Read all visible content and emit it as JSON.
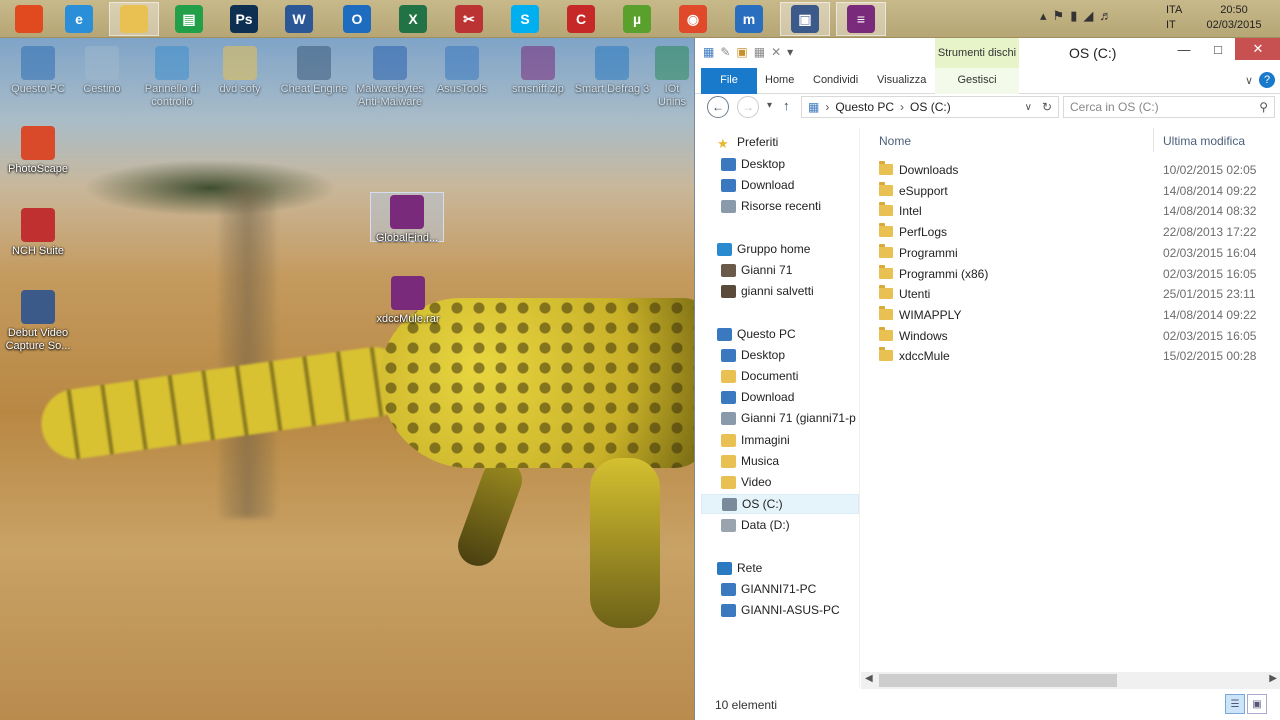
{
  "taskbar": {
    "apps": [
      {
        "icon": "windows-start-icon",
        "color": "#e04a1e",
        "glyph": "",
        "active": false
      },
      {
        "icon": "internet-explorer-icon",
        "color": "#2a8fd8",
        "glyph": "e",
        "active": false
      },
      {
        "icon": "file-explorer-icon",
        "color": "#e8c152",
        "glyph": "",
        "active": true
      },
      {
        "icon": "store-icon",
        "color": "#22a049",
        "glyph": "▤",
        "active": false
      },
      {
        "icon": "photoshop-icon",
        "color": "#0c2f52",
        "glyph": "Ps",
        "active": false
      },
      {
        "icon": "word-icon",
        "color": "#2b5797",
        "glyph": "W",
        "active": false
      },
      {
        "icon": "outlook-icon",
        "color": "#1e6cbf",
        "glyph": "O",
        "active": false
      },
      {
        "icon": "excel-icon",
        "color": "#217346",
        "glyph": "X",
        "active": false
      },
      {
        "icon": "snipping-tool-icon",
        "color": "#b33",
        "glyph": "✂",
        "active": false
      },
      {
        "icon": "skype-icon",
        "color": "#00aff0",
        "glyph": "S",
        "active": false
      },
      {
        "icon": "ccleaner-icon",
        "color": "#c62828",
        "glyph": "C",
        "active": false
      },
      {
        "icon": "utorrent-icon",
        "color": "#5aa02c",
        "glyph": "µ",
        "active": false
      },
      {
        "icon": "chrome-icon",
        "color": "#e04a2a",
        "glyph": "◉",
        "active": false
      },
      {
        "icon": "maxthon-icon",
        "color": "#2a6fbf",
        "glyph": "m",
        "active": false
      },
      {
        "icon": "debut-video-icon",
        "color": "#3b5a8a",
        "glyph": "▣",
        "active": true
      },
      {
        "icon": "winrar-icon",
        "color": "#7a2a7a",
        "glyph": "≡",
        "active": true
      }
    ],
    "tray": {
      "lang_top": "ITA",
      "lang_bottom": "IT",
      "time": "20:50",
      "date": "02/03/2015"
    }
  },
  "desktop": {
    "icons": [
      {
        "label": "Questo PC",
        "name": "this-pc-icon",
        "color": "#2f6fb5",
        "faded": true
      },
      {
        "label": "Cestino",
        "name": "recycle-bin-icon",
        "color": "#9fb8cc",
        "faded": true
      },
      {
        "label": "Pannello di controllo",
        "name": "control-panel-icon",
        "color": "#3d8fcf",
        "faded": true
      },
      {
        "label": "dvd sofy",
        "name": "dvd-sofy-folder-icon",
        "color": "#e8c152",
        "faded": true
      },
      {
        "label": "Cheat Engine",
        "name": "cheat-engine-icon",
        "color": "#3a5a7a",
        "faded": true
      },
      {
        "label": "Malwarebytes Anti-Malware",
        "name": "malwarebytes-icon",
        "color": "#2a62b0",
        "faded": true
      },
      {
        "label": "AsusTools",
        "name": "asustools-icon",
        "color": "#3a78c0",
        "faded": true
      },
      {
        "label": "smsniff.zip",
        "name": "smsniff-zip-icon",
        "color": "#7a2a7a",
        "faded": true
      },
      {
        "label": "Smart Defrag 3",
        "name": "smart-defrag-icon",
        "color": "#2a7ac0",
        "faded": true
      },
      {
        "label": "IOt Unins",
        "name": "iobit-uninstaller-icon",
        "color": "#2a8a5a",
        "faded": true
      },
      {
        "label": "PhotoScape",
        "name": "photoscape-icon",
        "color": "#d84a2a",
        "faded": false
      },
      {
        "label": "NCH Suite",
        "name": "nch-suite-icon",
        "color": "#c03030",
        "faded": false
      },
      {
        "label": "Debut Video Capture So...",
        "name": "debut-video-capture-icon",
        "color": "#3b5a8a",
        "faded": false
      },
      {
        "label": "GlobalFind...",
        "name": "globalfind-rar-icon",
        "color": "#7a2a7a",
        "faded": false
      },
      {
        "label": "xdccMule.rar",
        "name": "xdccmule-rar-icon",
        "color": "#7a2a7a",
        "faded": false
      }
    ]
  },
  "explorer": {
    "title": "OS (C:)",
    "context_tab_title": "Strumenti dischi",
    "ribbon_tabs": [
      "File",
      "Home",
      "Condividi",
      "Visualizza",
      "Gestisci"
    ],
    "address": [
      "Questo PC",
      "OS (C:)"
    ],
    "search_placeholder": "Cerca in OS (C:)",
    "nav": [
      {
        "label": "Preferiti",
        "level": 0,
        "icon": "star-icon",
        "color": "#e8b830"
      },
      {
        "label": "Desktop",
        "level": 1,
        "icon": "desktop-icon",
        "color": "#3a78c0"
      },
      {
        "label": "Download",
        "level": 1,
        "icon": "download-folder-icon",
        "color": "#3a78c0"
      },
      {
        "label": "Risorse recenti",
        "level": 1,
        "icon": "recent-places-icon",
        "color": "#8a9aaa"
      },
      {
        "label": "Gruppo home",
        "level": 0,
        "icon": "homegroup-icon",
        "color": "#2a8ad0"
      },
      {
        "label": "Gianni 71",
        "level": 1,
        "icon": "user-avatar-icon",
        "color": "#6a5a4a"
      },
      {
        "label": "gianni salvetti",
        "level": 1,
        "icon": "user-avatar-icon",
        "color": "#5a4a3a"
      },
      {
        "label": "Questo PC",
        "level": 0,
        "icon": "this-pc-icon",
        "color": "#3a78c0"
      },
      {
        "label": "Desktop",
        "level": 1,
        "icon": "desktop-icon",
        "color": "#3a78c0"
      },
      {
        "label": "Documenti",
        "level": 1,
        "icon": "documents-folder-icon",
        "color": "#e8c152"
      },
      {
        "label": "Download",
        "level": 1,
        "icon": "download-folder-icon",
        "color": "#3a78c0"
      },
      {
        "label": "Gianni 71 (gianni71-p",
        "level": 1,
        "icon": "user-folder-icon",
        "color": "#8a9aaa"
      },
      {
        "label": "Immagini",
        "level": 1,
        "icon": "pictures-folder-icon",
        "color": "#e8c152"
      },
      {
        "label": "Musica",
        "level": 1,
        "icon": "music-folder-icon",
        "color": "#e8c152"
      },
      {
        "label": "Video",
        "level": 1,
        "icon": "videos-folder-icon",
        "color": "#e8c152"
      },
      {
        "label": "OS (C:)",
        "level": 1,
        "icon": "drive-c-icon",
        "color": "#7a8a9a",
        "selected": true
      },
      {
        "label": "Data (D:)",
        "level": 1,
        "icon": "drive-d-icon",
        "color": "#9aa4ae"
      },
      {
        "label": "Rete",
        "level": 0,
        "icon": "network-icon",
        "color": "#2a7ac0"
      },
      {
        "label": "GIANNI71-PC",
        "level": 1,
        "icon": "network-pc-icon",
        "color": "#3a78c0"
      },
      {
        "label": "GIANNI-ASUS-PC",
        "level": 1,
        "icon": "network-pc-icon",
        "color": "#3a78c0"
      }
    ],
    "columns": {
      "name": "Nome",
      "modified": "Ultima modifica"
    },
    "files": [
      {
        "name": "Downloads",
        "date": "10/02/2015 02:05"
      },
      {
        "name": "eSupport",
        "date": "14/08/2014 09:22"
      },
      {
        "name": "Intel",
        "date": "14/08/2014 08:32"
      },
      {
        "name": "PerfLogs",
        "date": "22/08/2013 17:22"
      },
      {
        "name": "Programmi",
        "date": "02/03/2015 16:04"
      },
      {
        "name": "Programmi (x86)",
        "date": "02/03/2015 16:05"
      },
      {
        "name": "Utenti",
        "date": "25/01/2015 23:11"
      },
      {
        "name": "WIMAPPLY",
        "date": "14/08/2014 09:22"
      },
      {
        "name": "Windows",
        "date": "02/03/2015 16:05"
      },
      {
        "name": "xdccMule",
        "date": "15/02/2015 00:28"
      }
    ],
    "status": "10 elementi"
  }
}
